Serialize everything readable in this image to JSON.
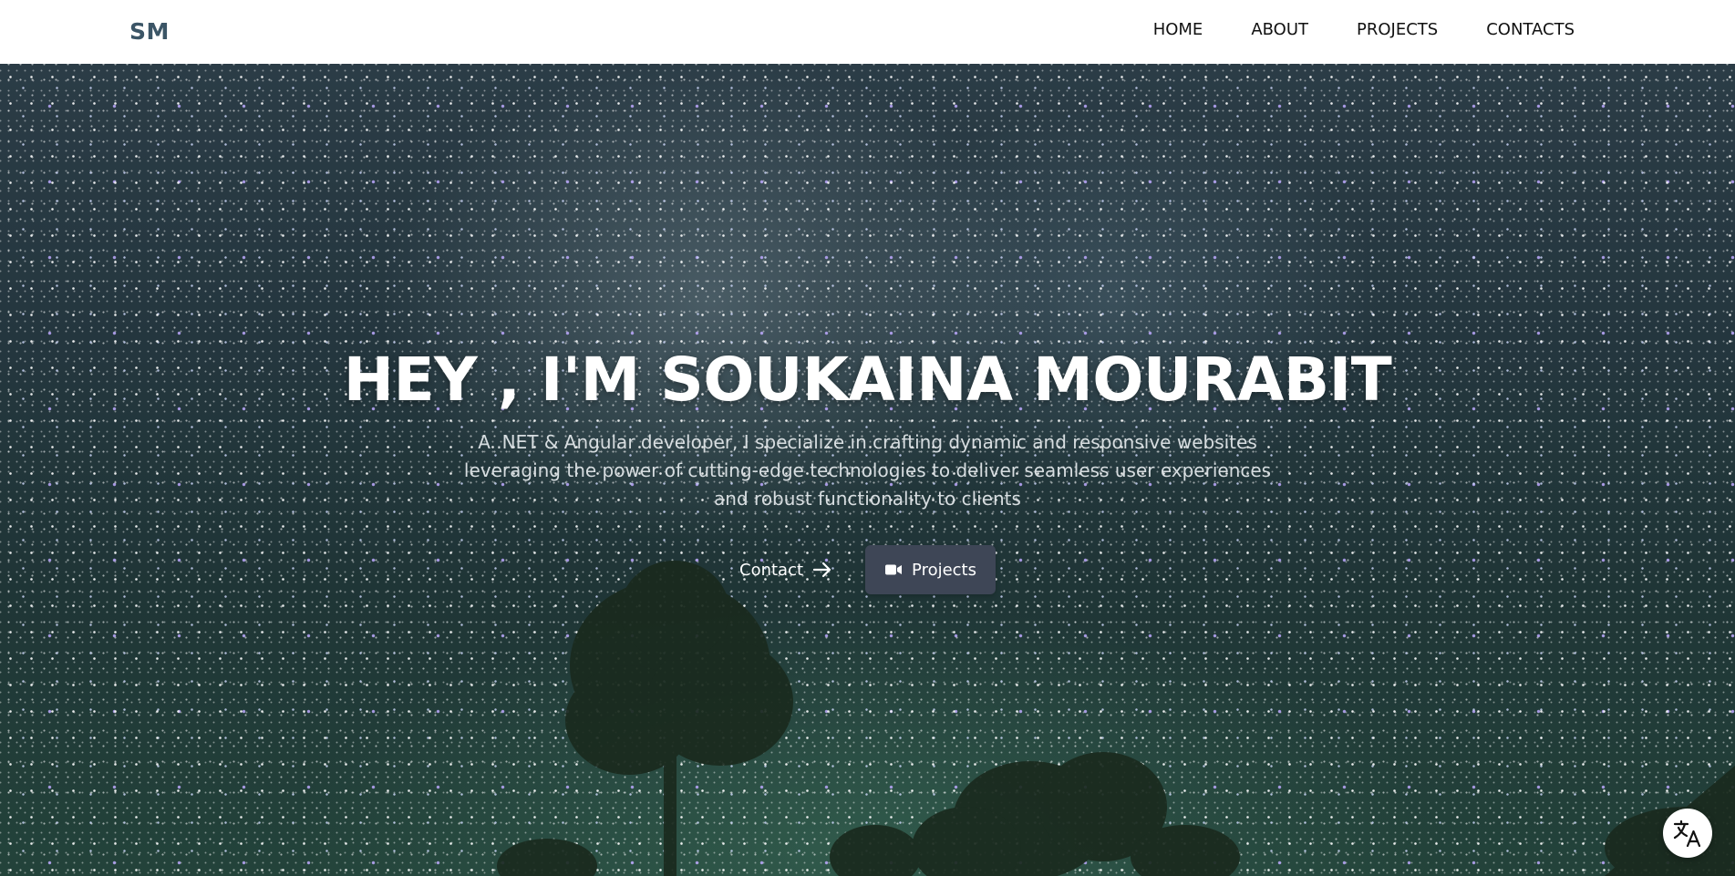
{
  "header": {
    "brand": "SM",
    "nav": [
      {
        "label": "HOME"
      },
      {
        "label": "ABOUT"
      },
      {
        "label": "PROJECTS"
      },
      {
        "label": "CONTACTS"
      }
    ]
  },
  "hero": {
    "title": "HEY , I'M SOUKAINA MOURABIT",
    "subtitle_lines": [
      "A .NET & Angular developer, I specialize in crafting dynamic and responsive websites",
      "leveraging the power of cutting-edge technologies to deliver seamless user experiences",
      "and robust functionality to clients"
    ],
    "contact_label": "Contact",
    "projects_label": "Projects"
  },
  "icons": {
    "contact": "arrow-right-icon",
    "projects": "video-camera-icon",
    "translate": "translate-icon"
  },
  "colors": {
    "brand": "#3b5566",
    "projects_button": "#3e4656",
    "navbar_bg": "#ffffff"
  }
}
